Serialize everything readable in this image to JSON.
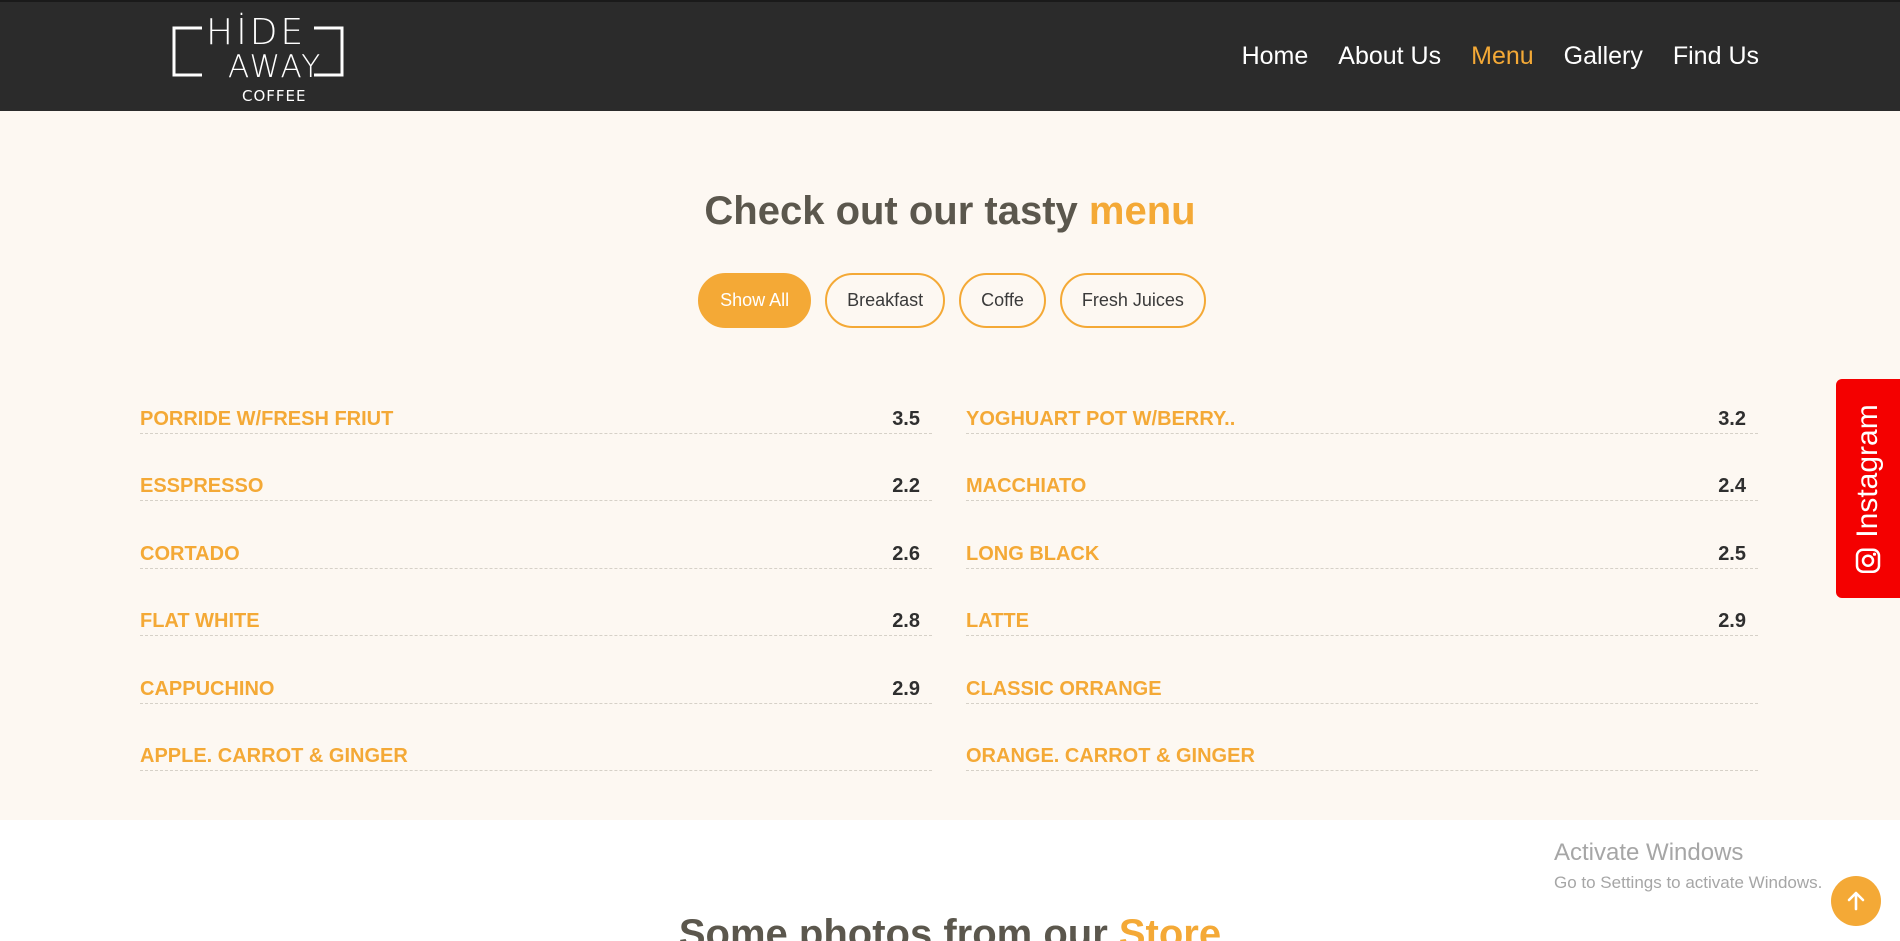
{
  "brand": {
    "line1": "HİDE",
    "line2": "AWAY",
    "line3": "COFFEE",
    "accent_color": "#f4a936",
    "header_bg": "#2b2b2b"
  },
  "nav": {
    "items": [
      {
        "label": "Home",
        "active": false
      },
      {
        "label": "About Us",
        "active": false
      },
      {
        "label": "Menu",
        "active": true
      },
      {
        "label": "Gallery",
        "active": false
      },
      {
        "label": "Find Us",
        "active": false
      }
    ]
  },
  "menu_section": {
    "title_main": "Check out our tasty ",
    "title_accent": "menu",
    "filters": [
      {
        "label": "Show All",
        "active": true
      },
      {
        "label": "Breakfast",
        "active": false
      },
      {
        "label": "Coffe",
        "active": false
      },
      {
        "label": "Fresh Juices",
        "active": false
      }
    ],
    "items": [
      {
        "name": "PORRIDE W/FRESH FRIUT",
        "price": "3.5"
      },
      {
        "name": "YOGHUART POT W/BERRY..",
        "price": "3.2"
      },
      {
        "name": "ESSPRESSO",
        "price": "2.2"
      },
      {
        "name": "MACCHIATO",
        "price": "2.4"
      },
      {
        "name": "CORTADO",
        "price": "2.6"
      },
      {
        "name": "LONG BLACK",
        "price": "2.5"
      },
      {
        "name": "FLAT WHITE",
        "price": "2.8"
      },
      {
        "name": "LATTE",
        "price": "2.9"
      },
      {
        "name": "CAPPUCHINO",
        "price": "2.9"
      },
      {
        "name": "CLASSIC ORRANGE",
        "price": ""
      },
      {
        "name": "APPLE. CARROT & GINGER",
        "price": ""
      },
      {
        "name": "ORANGE. CARROT & GINGER",
        "price": ""
      }
    ]
  },
  "photos_section": {
    "title_main": "Some photos from our ",
    "title_accent": "Store"
  },
  "instagram": {
    "label": "Instagram",
    "color": "#f40000",
    "icon": "instagram-icon"
  },
  "watermark": {
    "title": "Activate Windows",
    "subtitle": "Go to Settings to activate Windows."
  },
  "scroll_top": {
    "icon": "arrow-up-icon"
  }
}
